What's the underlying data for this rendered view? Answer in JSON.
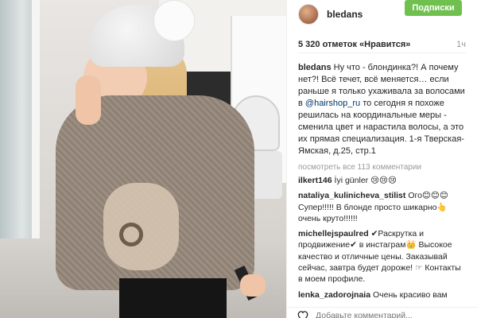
{
  "post": {
    "author": "bledans",
    "follow_label": "Подписки",
    "likes": "5 320 отметок «Нравится»",
    "time_ago": "1ч",
    "caption": {
      "author": "bledans",
      "text_before": "Ну что - блондинка?! А почему нет?! Всё течет, всё меняется… если раньше я только ухаживала за волосами в ",
      "mention": "@hairshop_ru",
      "text_after": " то сегодня я похоже решилась на координальные меры - сменила цвет и нарастила волосы, а это их прямая специализация. 1-я Тверская-Ямская, д.25, стр.1"
    },
    "view_all_comments": "посмотреть все 113 комментарии",
    "comments": [
      {
        "user": "ilkert146",
        "text": "İyi günler 😢😢😢"
      },
      {
        "user": "nataliya_kulinicheva_stilist",
        "text": "Ого😊😊😊 Супер!!!!! В блонде просто шикарно👆 очень круто!!!!!!"
      },
      {
        "user": "michellejspaulred",
        "text": "✔Раскрутка и продвижение✔ в инстаграм👑 Высокое качество и отличные цены. Заказывай сейчас, завтра будет дороже! ☞ Контакты в моем профиле."
      },
      {
        "user": "lenka_zadorojnaia",
        "text": "Очень красиво вам"
      }
    ],
    "add_comment_placeholder": "Добавьте комментарий..."
  },
  "icons": {
    "like": "heart-icon"
  },
  "colors": {
    "follow_button": "#70c050",
    "mention": "#003569"
  }
}
